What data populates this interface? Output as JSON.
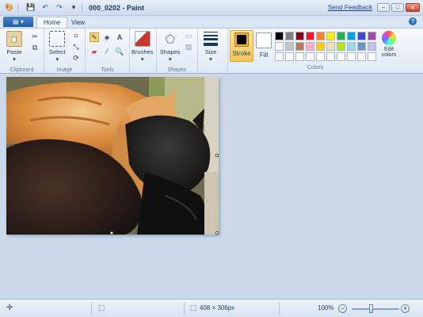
{
  "window": {
    "title": "000_0202 - Paint",
    "send_feedback": "Send Feedback",
    "minimize": "–",
    "maximize": "□",
    "close": "✕"
  },
  "quick_access": {
    "save_icon": "save-icon",
    "undo_icon": "undo-icon",
    "redo_icon": "redo-icon"
  },
  "tabs": {
    "app_button": "▤ ▾",
    "home": "Home",
    "view": "View"
  },
  "ribbon": {
    "clipboard": {
      "paste": "Paste",
      "label": "Clipboard"
    },
    "image": {
      "select": "Select",
      "label": "Image"
    },
    "tools": {
      "label": "Tools"
    },
    "brushes": {
      "label": "Brushes"
    },
    "shapes": {
      "shapes": "Shapes",
      "label": "Shapes"
    },
    "size": {
      "label": "Size"
    },
    "colors": {
      "stroke": "Stroke",
      "fill": "Fill",
      "edit_colors": "Edit colors",
      "label": "Colors",
      "stroke_color": "#000000",
      "fill_color": "#ffffff",
      "palette": [
        "#000000",
        "#7f7f7f",
        "#880015",
        "#ed1c24",
        "#ff7f27",
        "#fff200",
        "#22b14c",
        "#00a2e8",
        "#3f48cc",
        "#a349a4",
        "#ffffff",
        "#c3c3c3",
        "#b97a57",
        "#ffaec9",
        "#ffc90e",
        "#efe4b0",
        "#b5e61d",
        "#99d9ea",
        "#7092be",
        "#c8bfe7",
        "#ffffff",
        "#ffffff",
        "#ffffff",
        "#ffffff",
        "#ffffff",
        "#ffffff",
        "#ffffff",
        "#ffffff",
        "#ffffff",
        "#ffffff"
      ]
    }
  },
  "status": {
    "image_size": "408 × 306px",
    "zoom": "100%"
  }
}
